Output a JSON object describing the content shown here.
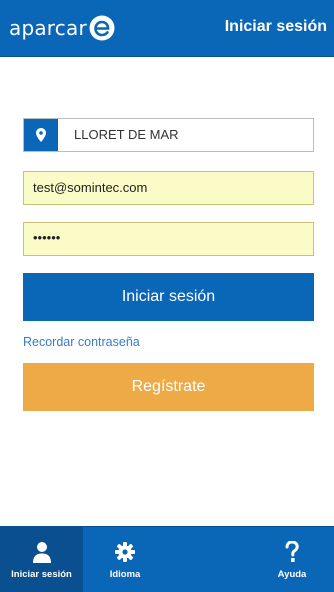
{
  "header": {
    "logo_text": "aparcar",
    "title": "Iniciar sesión"
  },
  "form": {
    "location_value": "LLORET DE MAR",
    "email_value": "test@somintec.com",
    "password_mask": "••••••",
    "login_label": "Iniciar sesión",
    "remember_label": "Recordar contraseña",
    "register_label": "Regístrate"
  },
  "bottom_nav": {
    "items": [
      {
        "label": "Iniciar sesión",
        "icon": "user-icon",
        "active": true
      },
      {
        "label": "Idioma",
        "icon": "gear-icon",
        "active": false
      },
      {
        "label": "Ayuda",
        "icon": "question-icon",
        "active": false
      }
    ]
  },
  "colors": {
    "primary": "#0a66b7",
    "accent": "#efaa48",
    "input_fill": "#fbfbc8",
    "link": "#3a7bc8"
  }
}
